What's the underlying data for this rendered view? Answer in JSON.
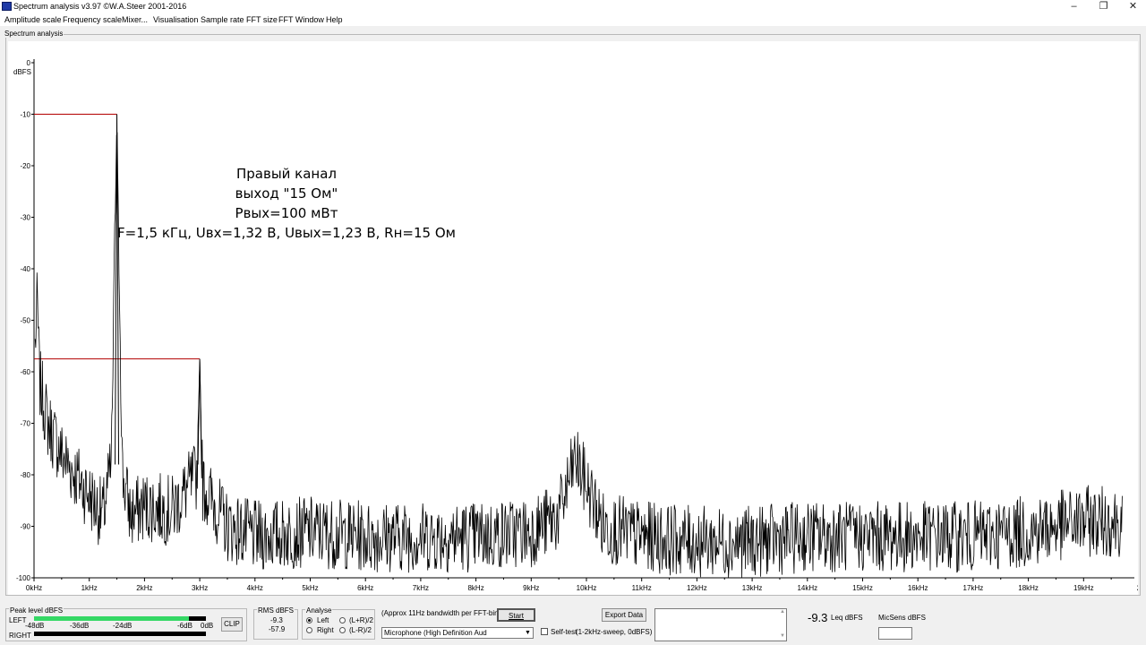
{
  "window": {
    "title": "Spectrum analysis v3.97  ©W.A.Steer 2001-2016",
    "minimize_glyph": "–",
    "restore_glyph": "❐",
    "close_glyph": "✕"
  },
  "menu": [
    "Amplitude scale",
    "Frequency scale",
    "Mixer...",
    "Visualisation",
    "Sample rate",
    "FFT size",
    "FFT Window",
    "Help"
  ],
  "spectrum": {
    "caption": "Spectrum analysis",
    "unit_label": "dBFS",
    "annotation": [
      "Правый канал",
      "выход \"15 Ом\"",
      "Рвых=100 мВт",
      "F=1,5 кГц, Uвх=1,32 В, Uвых=1,23 В, Rн=15 Ом"
    ]
  },
  "chart_data": {
    "type": "line",
    "ylabel": "dBFS",
    "ylim": [
      -100,
      0
    ],
    "y_ticks": [
      "0",
      "-10",
      "-20",
      "-30",
      "-40",
      "-50",
      "-60",
      "-70",
      "-80",
      "-90",
      "-100"
    ],
    "x_ticks": [
      "0kHz",
      "1kHz",
      "2kHz",
      "3kHz",
      "4kHz",
      "5kHz",
      "6kHz",
      "7kHz",
      "8kHz",
      "9kHz",
      "10kHz",
      "11kHz",
      "12kHz",
      "13kHz",
      "14kHz",
      "15kHz",
      "16kHz",
      "17kHz",
      "18kHz",
      "19kHz",
      "2"
    ],
    "xlim_khz": [
      0,
      19.7
    ],
    "peak_markers": [
      {
        "freq_khz": 1.5,
        "level_db": -10
      },
      {
        "freq_khz": 3.0,
        "level_db": -57.5
      }
    ],
    "series": [
      {
        "x_khz": [
          0.02,
          0.06,
          0.1,
          0.25,
          0.5,
          0.75,
          1.0,
          1.25,
          1.4,
          1.5,
          1.6,
          1.75,
          2.0,
          2.5,
          2.95,
          3.0,
          3.05,
          3.5,
          4.0,
          5.0,
          6.0,
          7.0,
          8.0,
          9.0,
          9.5,
          9.8,
          10.0,
          10.3,
          11.0,
          12.0,
          13.0,
          14.0,
          15.0,
          16.0,
          17.0,
          18.0,
          19.0,
          19.7
        ],
        "y_db": [
          -55,
          -46,
          -62,
          -70,
          -76,
          -80,
          -84,
          -88,
          -78,
          -10,
          -80,
          -88,
          -86,
          -87,
          -80,
          -57.5,
          -82,
          -90,
          -92,
          -91,
          -92,
          -92,
          -92,
          -91,
          -88,
          -77,
          -82,
          -90,
          -92,
          -93,
          -93,
          -92,
          -92,
          -92,
          -92,
          -91,
          -89,
          -89
        ]
      }
    ]
  },
  "bottom": {
    "peak": {
      "caption": "Peak level dBFS",
      "left_label": "LEFT",
      "right_label": "RIGHT",
      "scale": [
        "-48dB",
        "-36dB",
        "-24dB",
        "-6dB",
        "0dB"
      ],
      "left_level": 0.9,
      "right_level": 0.0,
      "clip_label": "CLIP"
    },
    "rms": {
      "caption": "RMS dBFS",
      "left": "-9.3",
      "right": "-57.9"
    },
    "analyse": {
      "caption": "Analyse",
      "options": [
        "Left",
        "Right",
        "(L+R)/2",
        "(L-R)/2"
      ],
      "selected": "Left"
    },
    "bandwidth_note": "(Approx 11Hz bandwidth per FFT-bin)",
    "start_label": "Start",
    "input_device": "Microphone (High Definition Aud",
    "selftest_label": "Self-test",
    "selftest_note": "(1-2kHz-sweep, 0dBFS)",
    "export_label": "Export Data",
    "leq_value": "-9.3",
    "leq_label": "Leq dBFS",
    "micsens_label": "MicSens dBFS"
  }
}
